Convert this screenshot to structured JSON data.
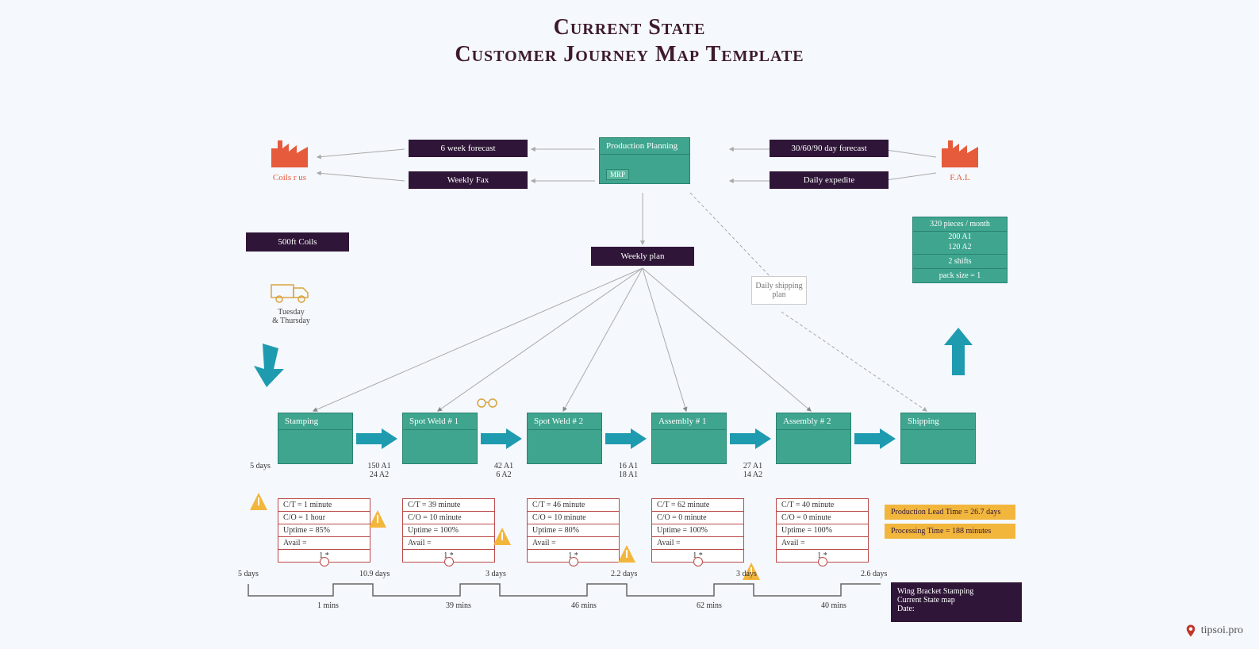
{
  "title": {
    "line1": "Current State",
    "line2": "Customer Journey Map Template"
  },
  "supplier": {
    "name": "Coils r us"
  },
  "customer": {
    "name": "F.A.L"
  },
  "top_boxes": {
    "forecast6w": "6 week forecast",
    "weekly_fax": "Weekly Fax",
    "forecast30": "30/60/90 day forecast",
    "daily_expedite": "Daily expedite"
  },
  "production_planning": {
    "title": "Production Planning",
    "sub": "MRP"
  },
  "coils": "500ft Coils",
  "weekly_plan": "Weekly plan",
  "daily_shipping": "Daily shipping plan",
  "demand": {
    "l1": "320 pieces / month",
    "l2": "200 A1",
    "l3": "120 A2",
    "l4": "2 shifts",
    "l5": "pack size = 1"
  },
  "truck_label": {
    "l1": "Tuesday",
    "l2": "& Thursday"
  },
  "processes": [
    {
      "name": "Stamping",
      "tri": "5 days",
      "ct": "C/T = 1 minute",
      "co": "C/O =  1 hour",
      "up": "Uptime =  85%",
      "avail": "Avail =",
      "slot": "1 *"
    },
    {
      "name": "Spot Weld # 1",
      "tri": "150 A1\n24 A2",
      "ct": "C/T = 39 minute",
      "co": "C/O = 10 minute",
      "up": "Uptime = 100%",
      "avail": "Avail =",
      "slot": "1 *"
    },
    {
      "name": "Spot Weld # 2",
      "tri": "42 A1\n6 A2",
      "ct": "C/T = 46 minute",
      "co": "C/O = 10 minute",
      "up": "Uptime = 80%",
      "avail": "Avail =",
      "slot": "1 *"
    },
    {
      "name": "Assembly # 1",
      "tri": "16 A1\n18 A1",
      "ct": "C/T = 62 minute",
      "co": "C/O = 0 minute",
      "up": "Uptime = 100%",
      "avail": "Avail =",
      "slot": "1 *"
    },
    {
      "name": "Assembly # 2",
      "tri": "27 A1\n14 A2",
      "ct": "C/T = 40 minute",
      "co": "C/O = 0 minute",
      "up": "Uptime = 100%",
      "avail": "Avail =",
      "slot": "1 *"
    },
    {
      "name": "Shipping",
      "tri": "",
      "ct": "",
      "co": "",
      "up": "",
      "avail": "",
      "slot": ""
    }
  ],
  "timeline": {
    "tops": [
      "5 days",
      "10.9 days",
      "3 days",
      "2.2 days",
      "3 days",
      "2.6 days"
    ],
    "bots": [
      "1 mins",
      "39 mins",
      "46 mins",
      "62 mins",
      "40 mins"
    ]
  },
  "summary": {
    "lead": "Production Lead Time = 26.7 days",
    "proc": "Processing Time = 188 minutes"
  },
  "footer": {
    "l1": "Wing Bracket Stamping",
    "l2": "Current State map",
    "l3": "Date:"
  },
  "watermark": "tipsoi.pro"
}
